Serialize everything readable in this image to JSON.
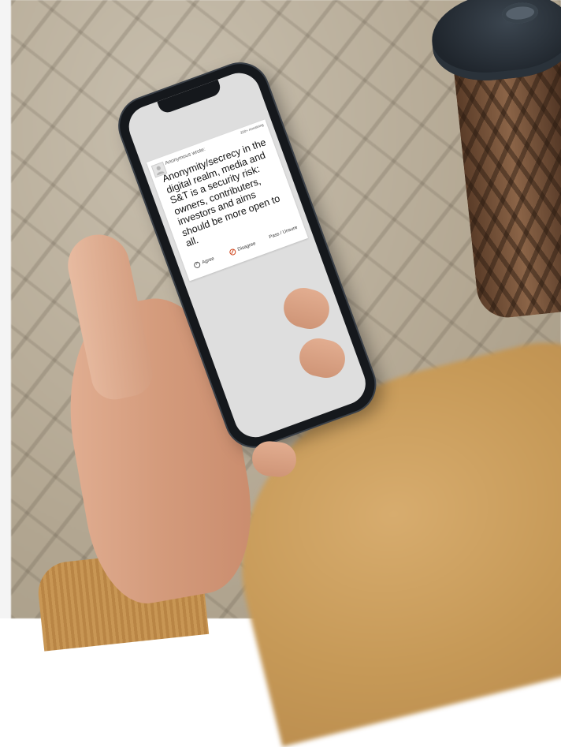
{
  "statement_card": {
    "author": "Anonymous wrote:",
    "remaining": "200+ remaining",
    "statement": "Anonymity/secrecy in the digital realm, media and S&T is a security risk: owners, contributers, investors and aims should be more open to all.",
    "actions": {
      "agree": "Agree",
      "disagree": "Disagree",
      "pass": "Pass / Unsure"
    }
  },
  "colors": {
    "disagree_icon": "#d0451b",
    "screen_background": "#dedede",
    "card_background": "#ffffff"
  },
  "icons": [
    "avatar-icon",
    "agree-check-icon",
    "disagree-ban-icon"
  ]
}
